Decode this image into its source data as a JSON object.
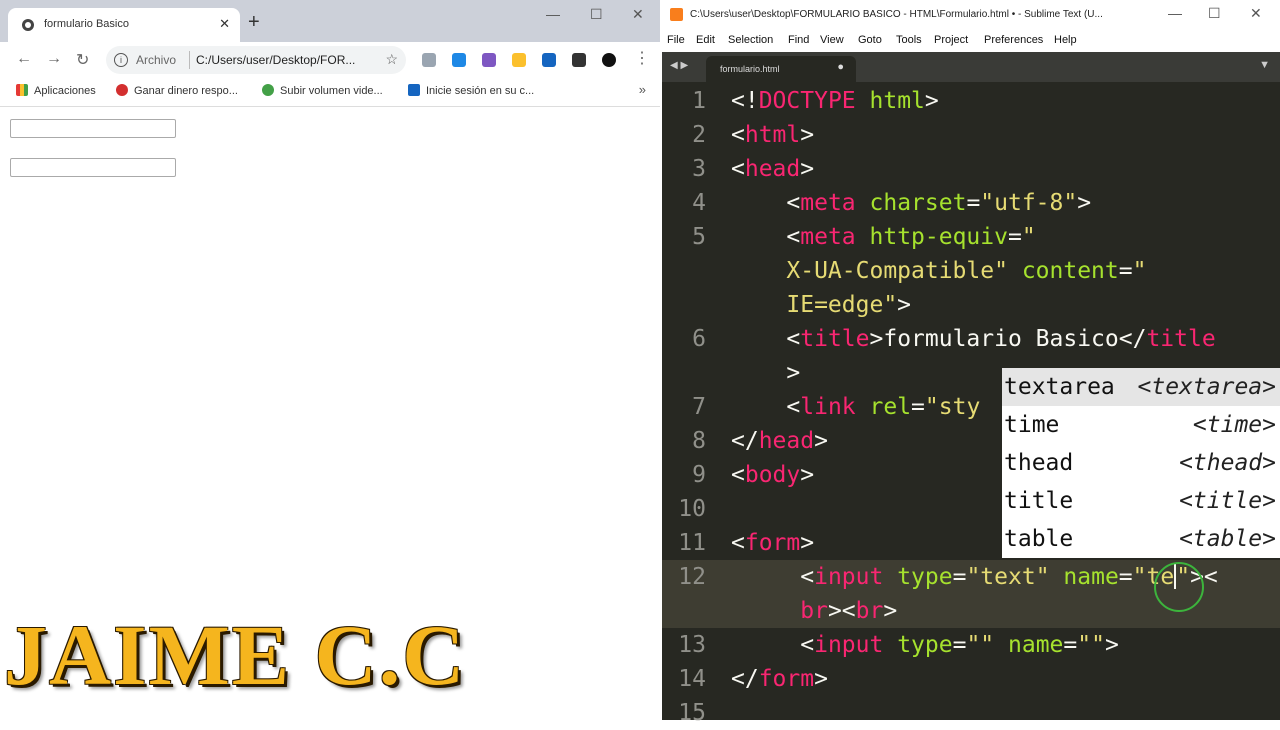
{
  "chrome": {
    "tab_title": "formulario Basico",
    "url_scheme": "Archivo",
    "url": "C:/Users/user/Desktop/FOR...",
    "bookmarks": [
      {
        "label": "Aplicaciones",
        "color": "#e53935"
      },
      {
        "label": "Ganar dinero respo...",
        "color": "#d32f2f"
      },
      {
        "label": "Subir volumen vide...",
        "color": "#43a047"
      },
      {
        "label": "Inicie sesión en su c...",
        "color": "#1565c0"
      }
    ],
    "form_inputs": [
      "",
      ""
    ]
  },
  "watermark": "JAIME C.C",
  "sublime": {
    "title": "C:\\Users\\user\\Desktop\\FORMULARIO BASICO - HTML\\Formulario.html • - Sublime Text (U...",
    "menu": [
      "File",
      "Edit",
      "Selection",
      "Find",
      "View",
      "Goto",
      "Tools",
      "Project",
      "Preferences",
      "Help"
    ],
    "tab": "formulario.html",
    "line_numbers": [
      "1",
      "2",
      "3",
      "4",
      "5",
      "",
      "",
      "6",
      "",
      "7",
      "8",
      "9",
      "10",
      "11",
      "12",
      "",
      "13",
      "14",
      "15"
    ],
    "autocomplete": [
      {
        "trigger": "textarea",
        "hint": "<textarea>"
      },
      {
        "trigger": "time",
        "hint": "<time>"
      },
      {
        "trigger": "thead",
        "hint": "<thead>"
      },
      {
        "trigger": "title",
        "hint": "<title>"
      },
      {
        "trigger": "table",
        "hint": "<table>"
      }
    ]
  },
  "colors": {
    "editor_bg": "#272822",
    "tag": "#f92672",
    "attr": "#a6e22e",
    "string": "#e6db74",
    "watermark": "#f5b51e"
  }
}
